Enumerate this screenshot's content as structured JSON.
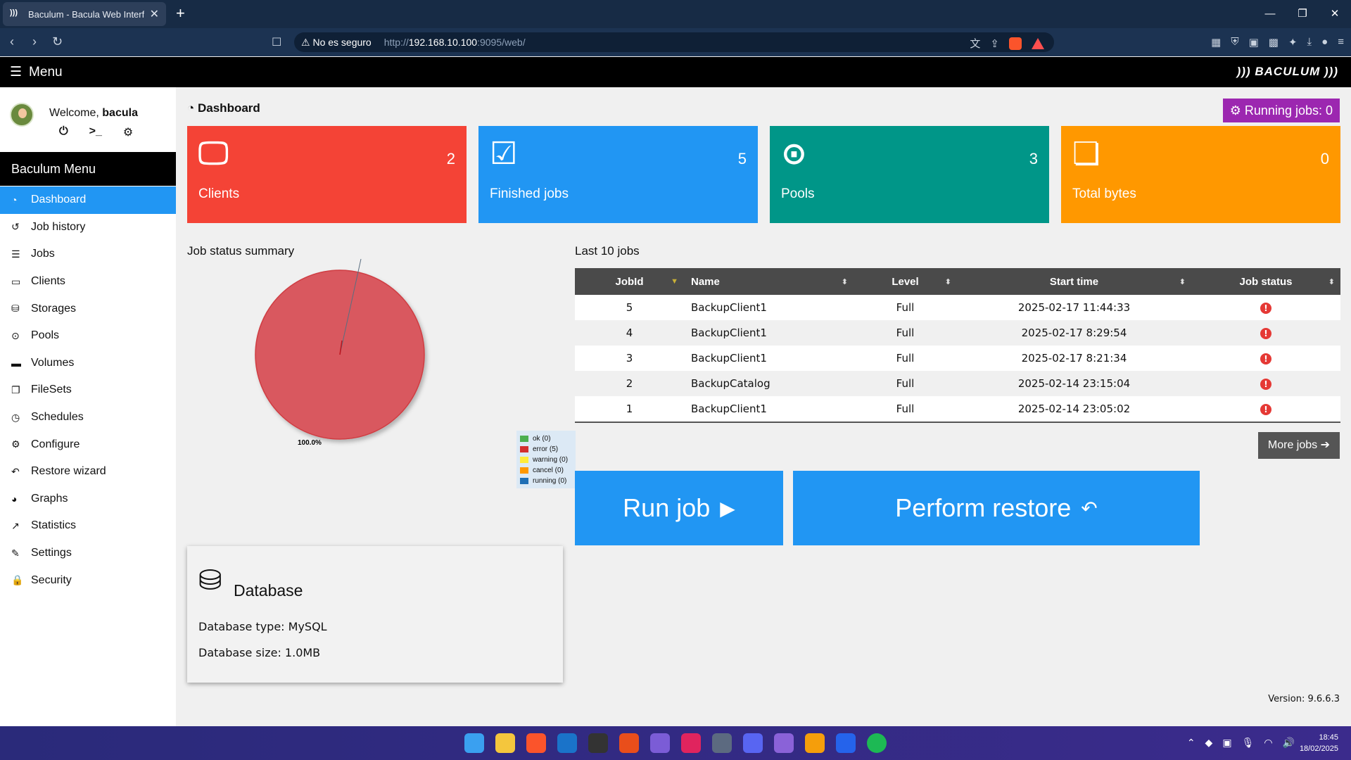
{
  "browser": {
    "tab_title": "Baculum - Bacula Web Interface",
    "security_label": "No es seguro",
    "url_protocol": "http://",
    "url_host": "192.168.10.100",
    "url_rest": ":9095/web/",
    "new_tab": "+",
    "tab_close": "✕"
  },
  "app": {
    "menu_label": "Menu",
    "logo_text": "))) BACULUM )))"
  },
  "sidebar": {
    "welcome_prefix": "Welcome, ",
    "username": "bacula",
    "menu_header": "Baculum Menu",
    "items": [
      {
        "label": "Dashboard",
        "icon": "dashboard-icon"
      },
      {
        "label": "Job history",
        "icon": "history-icon"
      },
      {
        "label": "Jobs",
        "icon": "list-icon"
      },
      {
        "label": "Clients",
        "icon": "desktop-icon"
      },
      {
        "label": "Storages",
        "icon": "database-icon"
      },
      {
        "label": "Pools",
        "icon": "tape-icon"
      },
      {
        "label": "Volumes",
        "icon": "hdd-icon"
      },
      {
        "label": "FileSets",
        "icon": "copy-icon"
      },
      {
        "label": "Schedules",
        "icon": "clock-icon"
      },
      {
        "label": "Configure",
        "icon": "gear-icon"
      },
      {
        "label": "Restore wizard",
        "icon": "undo-icon"
      },
      {
        "label": "Graphs",
        "icon": "pie-chart-icon"
      },
      {
        "label": "Statistics",
        "icon": "line-chart-icon"
      },
      {
        "label": "Settings",
        "icon": "wrench-icon"
      },
      {
        "label": "Security",
        "icon": "lock-icon"
      }
    ]
  },
  "dashboard": {
    "title": "Dashboard",
    "running_jobs": "Running jobs: 0",
    "cards": [
      {
        "label": "Clients",
        "value": "2",
        "color": "#f44336",
        "icon": "monitor-icon"
      },
      {
        "label": "Finished jobs",
        "value": "5",
        "color": "#2196f3",
        "icon": "tasks-icon"
      },
      {
        "label": "Pools",
        "value": "3",
        "color": "#009688",
        "icon": "tape-icon"
      },
      {
        "label": "Total bytes",
        "value": "0",
        "color": "#ff9800",
        "icon": "files-icon"
      }
    ],
    "job_status_summary_title": "Job status summary",
    "pie_label": "100.0%",
    "legend": [
      {
        "label": "ok (0)",
        "color": "#4caf50"
      },
      {
        "label": "error (5)",
        "color": "#d32f2f"
      },
      {
        "label": "warning (0)",
        "color": "#ffeb3b"
      },
      {
        "label": "cancel (0)",
        "color": "#ff9800"
      },
      {
        "label": "running (0)",
        "color": "#1f6fb5"
      }
    ],
    "last_jobs_title": "Last 10 jobs",
    "table_headers": [
      "JobId",
      "Name",
      "Level",
      "Start time",
      "Job status"
    ],
    "jobs": [
      {
        "id": "5",
        "name": "BackupClient1",
        "level": "Full",
        "start": "2025-02-17 11:44:33"
      },
      {
        "id": "4",
        "name": "BackupClient1",
        "level": "Full",
        "start": "2025-02-17 8:29:54"
      },
      {
        "id": "3",
        "name": "BackupClient1",
        "level": "Full",
        "start": "2025-02-17 8:21:34"
      },
      {
        "id": "2",
        "name": "BackupCatalog",
        "level": "Full",
        "start": "2025-02-14 23:15:04"
      },
      {
        "id": "1",
        "name": "BackupClient1",
        "level": "Full",
        "start": "2025-02-14 23:05:02"
      }
    ],
    "more_jobs": "More jobs",
    "run_job": "Run job",
    "perform_restore": "Perform restore",
    "database": {
      "title": "Database",
      "type_line": "Database type: MySQL",
      "size_line": "Database size: 1.0MB"
    },
    "version": "Version: 9.6.6.3"
  },
  "taskbar": {
    "time": "18:45",
    "date": "18/02/2025"
  }
}
